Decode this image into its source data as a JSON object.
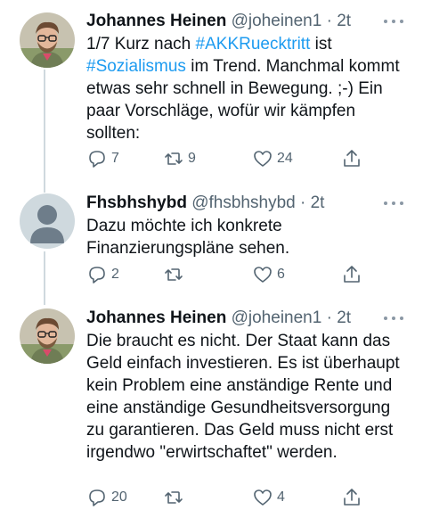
{
  "tweets": [
    {
      "name": "Johannes Heinen",
      "handle": "@joheinen1",
      "sep": "·",
      "time": "2t",
      "text_prefix": "1/7 Kurz nach ",
      "hashtag1": "#AKKRuecktritt",
      "text_mid": " ist",
      "hashtag2": "#Sozialismus",
      "text_suffix": " im Trend. Manchmal kommt etwas sehr schnell in Bewegung. ;-) Ein paar Vorschläge, wofür wir kämpfen sollten:",
      "replies": "7",
      "retweets": "9",
      "likes": "24",
      "avatar": "person-photo"
    },
    {
      "name": "Fhsbhshybd",
      "handle": "@fhsbhshybd",
      "sep": "·",
      "time": "2t",
      "text": "Dazu möchte ich konkrete Finanzierungspläne sehen.",
      "replies": "2",
      "retweets": "",
      "likes": "6",
      "avatar": "default-avatar"
    },
    {
      "name": "Johannes Heinen",
      "handle": "@joheinen1",
      "sep": "·",
      "time": "2t",
      "text": "Die braucht es nicht. Der Staat kann das Geld einfach investieren. Es ist überhaupt kein Problem eine anständige Rente und eine anständige Gesundheitsversorgung zu garantieren. Das Geld muss nicht erst irgendwo \"erwirtschaftet\" werden.",
      "replies": "20",
      "retweets": "",
      "likes": "4",
      "avatar": "person-photo"
    }
  ],
  "colors": {
    "link": "#1d9bf0",
    "secondary": "#536471",
    "thread_line": "#cfd9de"
  }
}
